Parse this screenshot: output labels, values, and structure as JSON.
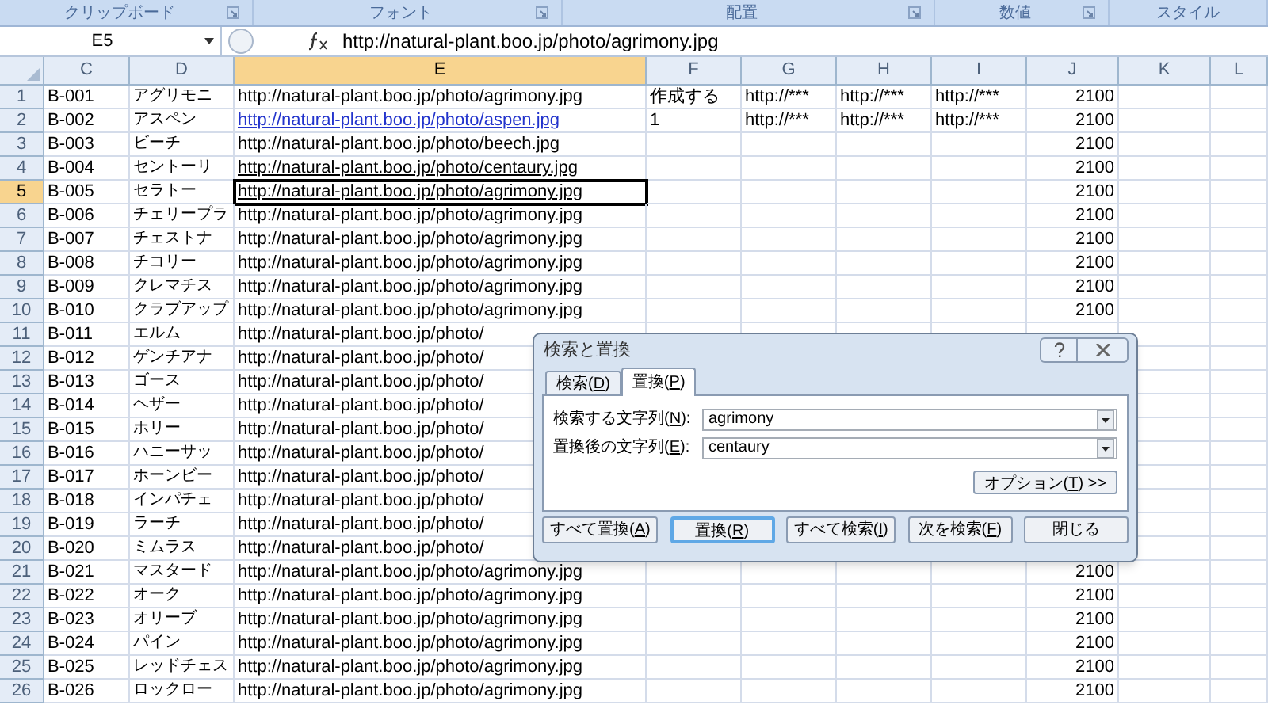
{
  "ribbon_groups": [
    {
      "label": "クリップボード"
    },
    {
      "label": "フォント"
    },
    {
      "label": "配置"
    },
    {
      "label": "数値"
    },
    {
      "label": "スタイル"
    }
  ],
  "name_box": "E5",
  "formula": "http://natural-plant.boo.jp/photo/agrimony.jpg",
  "columns": [
    {
      "label": "C",
      "selected": false
    },
    {
      "label": "D",
      "selected": false
    },
    {
      "label": "E",
      "selected": true
    },
    {
      "label": "F",
      "selected": false
    },
    {
      "label": "G",
      "selected": false
    },
    {
      "label": "H",
      "selected": false
    },
    {
      "label": "I",
      "selected": false
    },
    {
      "label": "J",
      "selected": false
    },
    {
      "label": "K",
      "selected": false
    },
    {
      "label": "L",
      "selected": false
    }
  ],
  "rows": [
    {
      "number": "1",
      "selected": false,
      "cells": [
        "B-001",
        "アグリモニ",
        "http://natural-plant.boo.jp/photo/agrimony.jpg",
        "作成する",
        "http://***",
        "http://***",
        "http://***",
        "2100"
      ]
    },
    {
      "number": "2",
      "selected": false,
      "kind": "hyperlink",
      "cells": [
        "B-002",
        "アスペン",
        "http://natural-plant.boo.jp/photo/aspen.jpg",
        "1",
        "http://***",
        "http://***",
        "http://***",
        "2100"
      ]
    },
    {
      "number": "3",
      "selected": false,
      "cells": [
        "B-003",
        "ビーチ",
        "http://natural-plant.boo.jp/photo/beech.jpg",
        "",
        "",
        "",
        "",
        "2100"
      ]
    },
    {
      "number": "4",
      "selected": false,
      "kind": "underlined",
      "cells": [
        "B-004",
        "セントーリ",
        "http://natural-plant.boo.jp/photo/centaury.jpg",
        "",
        "",
        "",
        "",
        "2100"
      ]
    },
    {
      "number": "5",
      "selected": true,
      "kind": "underlined",
      "cells": [
        "B-005",
        "セラトー",
        "http://natural-plant.boo.jp/photo/agrimony.jpg",
        "",
        "",
        "",
        "",
        "2100"
      ]
    },
    {
      "number": "6",
      "selected": false,
      "cells": [
        "B-006",
        "チェリープラ",
        "http://natural-plant.boo.jp/photo/agrimony.jpg",
        "",
        "",
        "",
        "",
        "2100"
      ]
    },
    {
      "number": "7",
      "selected": false,
      "cells": [
        "B-007",
        "チェストナ",
        "http://natural-plant.boo.jp/photo/agrimony.jpg",
        "",
        "",
        "",
        "",
        "2100"
      ]
    },
    {
      "number": "8",
      "selected": false,
      "cells": [
        "B-008",
        "チコリー",
        "http://natural-plant.boo.jp/photo/agrimony.jpg",
        "",
        "",
        "",
        "",
        "2100"
      ]
    },
    {
      "number": "9",
      "selected": false,
      "cells": [
        "B-009",
        "クレマチス",
        "http://natural-plant.boo.jp/photo/agrimony.jpg",
        "",
        "",
        "",
        "",
        "2100"
      ]
    },
    {
      "number": "10",
      "selected": false,
      "cells": [
        "B-010",
        "クラブアップ",
        "http://natural-plant.boo.jp/photo/agrimony.jpg",
        "",
        "",
        "",
        "",
        "2100"
      ]
    },
    {
      "number": "11",
      "selected": false,
      "cells": [
        "B-011",
        "エルム",
        "http://natural-plant.boo.jp/photo/",
        "",
        "",
        "",
        "",
        ""
      ]
    },
    {
      "number": "12",
      "selected": false,
      "cells": [
        "B-012",
        "ゲンチアナ",
        "http://natural-plant.boo.jp/photo/",
        "",
        "",
        "",
        "",
        ""
      ]
    },
    {
      "number": "13",
      "selected": false,
      "cells": [
        "B-013",
        "ゴース",
        "http://natural-plant.boo.jp/photo/",
        "",
        "",
        "",
        "",
        ""
      ]
    },
    {
      "number": "14",
      "selected": false,
      "cells": [
        "B-014",
        "ヘザー",
        "http://natural-plant.boo.jp/photo/",
        "",
        "",
        "",
        "",
        ""
      ]
    },
    {
      "number": "15",
      "selected": false,
      "cells": [
        "B-015",
        "ホリー",
        "http://natural-plant.boo.jp/photo/",
        "",
        "",
        "",
        "",
        ""
      ]
    },
    {
      "number": "16",
      "selected": false,
      "cells": [
        "B-016",
        "ハニーサッ",
        "http://natural-plant.boo.jp/photo/",
        "",
        "",
        "",
        "",
        ""
      ]
    },
    {
      "number": "17",
      "selected": false,
      "cells": [
        "B-017",
        "ホーンビー",
        "http://natural-plant.boo.jp/photo/",
        "",
        "",
        "",
        "",
        ""
      ]
    },
    {
      "number": "18",
      "selected": false,
      "cells": [
        "B-018",
        "インパチェ",
        "http://natural-plant.boo.jp/photo/",
        "",
        "",
        "",
        "",
        ""
      ]
    },
    {
      "number": "19",
      "selected": false,
      "cells": [
        "B-019",
        "ラーチ",
        "http://natural-plant.boo.jp/photo/",
        "",
        "",
        "",
        "",
        ""
      ]
    },
    {
      "number": "20",
      "selected": false,
      "cells": [
        "B-020",
        "ミムラス",
        "http://natural-plant.boo.jp/photo/",
        "",
        "",
        "",
        "",
        ""
      ]
    },
    {
      "number": "21",
      "selected": false,
      "cells": [
        "B-021",
        "マスタード",
        "http://natural-plant.boo.jp/photo/agrimony.jpg",
        "",
        "",
        "",
        "",
        "2100"
      ]
    },
    {
      "number": "22",
      "selected": false,
      "cells": [
        "B-022",
        "オーク",
        "http://natural-plant.boo.jp/photo/agrimony.jpg",
        "",
        "",
        "",
        "",
        "2100"
      ]
    },
    {
      "number": "23",
      "selected": false,
      "cells": [
        "B-023",
        "オリーブ",
        "http://natural-plant.boo.jp/photo/agrimony.jpg",
        "",
        "",
        "",
        "",
        "2100"
      ]
    },
    {
      "number": "24",
      "selected": false,
      "cells": [
        "B-024",
        "パイン",
        "http://natural-plant.boo.jp/photo/agrimony.jpg",
        "",
        "",
        "",
        "",
        "2100"
      ]
    },
    {
      "number": "25",
      "selected": false,
      "cells": [
        "B-025",
        "レッドチェス",
        "http://natural-plant.boo.jp/photo/agrimony.jpg",
        "",
        "",
        "",
        "",
        "2100"
      ]
    },
    {
      "number": "26",
      "selected": false,
      "cells": [
        "B-026",
        "ロックロー",
        "http://natural-plant.boo.jp/photo/agrimony.jpg",
        "",
        "",
        "",
        "",
        "2100"
      ]
    }
  ],
  "dialog": {
    "title": "検索と置換",
    "tabs": [
      {
        "label": "検索(D)",
        "selected": false
      },
      {
        "label": "置換(P)",
        "selected": true
      }
    ],
    "fields": [
      {
        "label": "検索する文字列(N):",
        "value": "agrimony"
      },
      {
        "label": "置換後の文字列(E):",
        "value": "centaury"
      }
    ],
    "options_button": "オプション(T) >>",
    "buttons": [
      {
        "label": "すべて置換(A)",
        "selected": false
      },
      {
        "label": "置換(R)",
        "selected": true
      },
      {
        "label": "すべて検索(I)",
        "selected": false
      },
      {
        "label": "次を検索(F)",
        "selected": false
      },
      {
        "label": "閉じる",
        "selected": false
      }
    ]
  }
}
